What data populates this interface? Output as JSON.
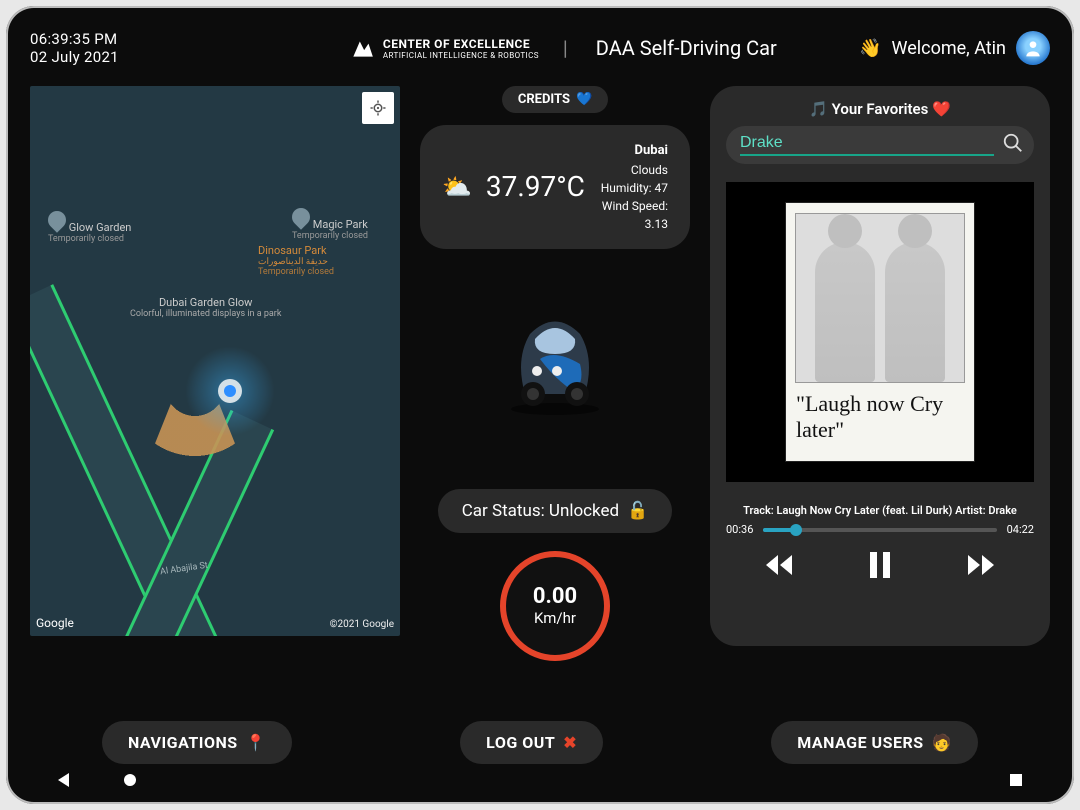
{
  "datetime": {
    "time": "06:39:35 PM",
    "date": "02 July 2021"
  },
  "brand": {
    "name": "CENTER OF EXCELLENCE",
    "sub": "ARTIFICIAL INTELLIGENCE & ROBOTICS"
  },
  "app_title": "DAA Self-Driving Car",
  "welcome": {
    "greeting": "Welcome, Atin"
  },
  "credits_label": "CREDITS",
  "weather": {
    "temp": "37.97°C",
    "city": "Dubai",
    "condition": "Clouds",
    "humidity_label": "Humidity: 47",
    "wind_label": "Wind Speed: 3.13"
  },
  "map": {
    "poi_glow": "Glow Garden",
    "poi_glow_sub": "Temporarily closed",
    "poi_magic": "Magic Park",
    "poi_magic_sub": "Temporarily closed",
    "poi_dino": "Dinosaur Park",
    "poi_dino_ar": "حديقة الديناصورات",
    "poi_dino_sub": "Temporarily closed",
    "poi_garden": "Dubai Garden Glow",
    "poi_garden_sub": "Colorful, illuminated\ndisplays in a park",
    "street": "Al Abajila St",
    "google": "Google",
    "copyright": "©2021 Google"
  },
  "car_status": {
    "label": "Car Status: Unlocked"
  },
  "speed": {
    "value": "0.00",
    "unit": "Km/hr"
  },
  "favorites_title": "Your Favorites",
  "search": {
    "value": "Drake"
  },
  "album_script": "\"Laugh now Cry later\"",
  "track_info": "Track: Laugh Now Cry Later (feat. Lil Durk) Artist: Drake",
  "player": {
    "elapsed": "00:36",
    "total": "04:22"
  },
  "buttons": {
    "navigations": "NAVIGATIONS",
    "logout": "LOG OUT",
    "manage_users": "MANAGE USERS"
  }
}
